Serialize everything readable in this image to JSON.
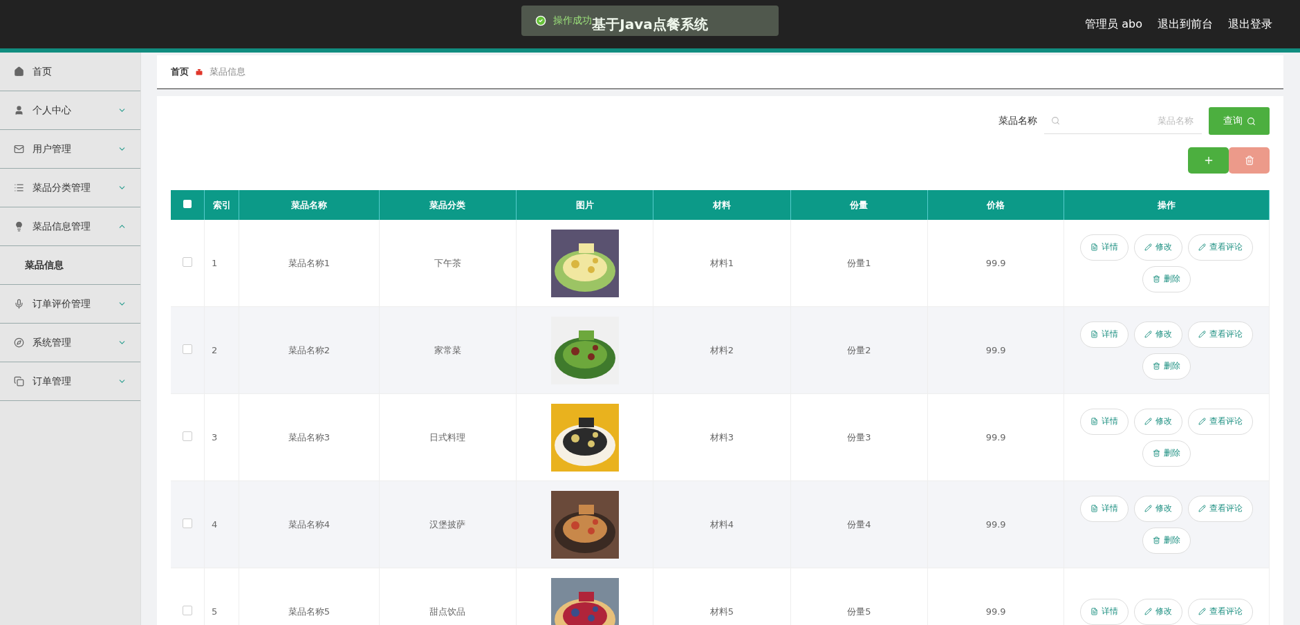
{
  "topbar": {
    "title": "基于Java点餐系统",
    "toast": {
      "text": "操作成功"
    },
    "links": [
      "管理员 abo",
      "退出到前台",
      "退出登录"
    ]
  },
  "sidebar": {
    "items": [
      {
        "label": "首页",
        "kind": "link"
      },
      {
        "label": "个人中心",
        "kind": "menu",
        "expanded": false
      },
      {
        "label": "用户管理",
        "kind": "menu",
        "expanded": false
      },
      {
        "label": "菜品分类管理",
        "kind": "menu",
        "expanded": false
      },
      {
        "label": "菜品信息管理",
        "kind": "menu",
        "expanded": true,
        "children": [
          {
            "label": "菜品信息"
          }
        ]
      },
      {
        "label": "订单评价管理",
        "kind": "menu",
        "expanded": false
      },
      {
        "label": "系统管理",
        "kind": "menu",
        "expanded": false
      },
      {
        "label": "订单管理",
        "kind": "menu",
        "expanded": false
      }
    ]
  },
  "breadcrumb": [
    "首页",
    "菜品信息"
  ],
  "search": {
    "label": "菜品名称",
    "placeholder": "菜品名称",
    "button": "查询"
  },
  "table": {
    "header_checked": false,
    "columns": [
      "索引",
      "菜品名称",
      "菜品分类",
      "图片",
      "材料",
      "份量",
      "价格",
      "操作"
    ],
    "rows": [
      {
        "checked": false,
        "index": "1",
        "name": "菜品名称1",
        "category": "下午茶",
        "picture": {
          "kind": "picture"
        },
        "material": "材料1",
        "portion": "份量1",
        "price": "99.9",
        "actions": [
          "详情",
          "修改",
          "查看评论",
          "删除"
        ]
      },
      {
        "checked": false,
        "index": "2",
        "name": "菜品名称2",
        "category": "家常菜",
        "picture": {
          "kind": "picture"
        },
        "material": "材料2",
        "portion": "份量2",
        "price": "99.9",
        "actions": [
          "详情",
          "修改",
          "查看评论",
          "删除"
        ]
      },
      {
        "checked": false,
        "index": "3",
        "name": "菜品名称3",
        "category": "日式料理",
        "picture": {
          "kind": "picture"
        },
        "material": "材料3",
        "portion": "份量3",
        "price": "99.9",
        "actions": [
          "详情",
          "修改",
          "查看评论",
          "删除"
        ]
      },
      {
        "checked": false,
        "index": "4",
        "name": "菜品名称4",
        "category": "汉堡披萨",
        "picture": {
          "kind": "picture"
        },
        "material": "材料4",
        "portion": "份量4",
        "price": "99.9",
        "actions": [
          "详情",
          "修改",
          "查看评论",
          "删除"
        ]
      },
      {
        "checked": false,
        "index": "5",
        "name": "菜品名称5",
        "category": "甜点饮品",
        "picture": {
          "kind": "picture"
        },
        "material": "材料5",
        "portion": "份量5",
        "price": "99.9",
        "actions": [
          "详情",
          "修改",
          "查看评论"
        ]
      }
    ]
  }
}
